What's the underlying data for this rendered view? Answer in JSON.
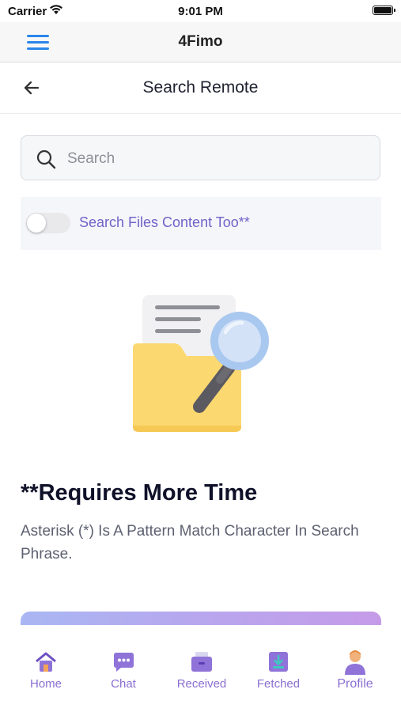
{
  "status_bar": {
    "carrier": "Carrier",
    "time": "9:01 PM"
  },
  "app_header": {
    "title": "4Fimo"
  },
  "page_header": {
    "title": "Search Remote"
  },
  "search": {
    "placeholder": "Search",
    "value": ""
  },
  "options": {
    "search_content_label": "Search Files Content Too**",
    "search_content_enabled": false
  },
  "info": {
    "heading": "**Requires More Time",
    "description": "Asterisk (*) Is A Pattern Match Character In Search Phrase."
  },
  "tabs": [
    {
      "label": "Home",
      "icon": "home-icon"
    },
    {
      "label": "Chat",
      "icon": "chat-icon"
    },
    {
      "label": "Received",
      "icon": "received-icon"
    },
    {
      "label": "Fetched",
      "icon": "fetched-icon"
    },
    {
      "label": "Profile",
      "icon": "profile-icon"
    }
  ],
  "colors": {
    "accent": "#2a86e8",
    "label_purple": "#6e63c8",
    "tab_purple": "#8a6fd1"
  }
}
